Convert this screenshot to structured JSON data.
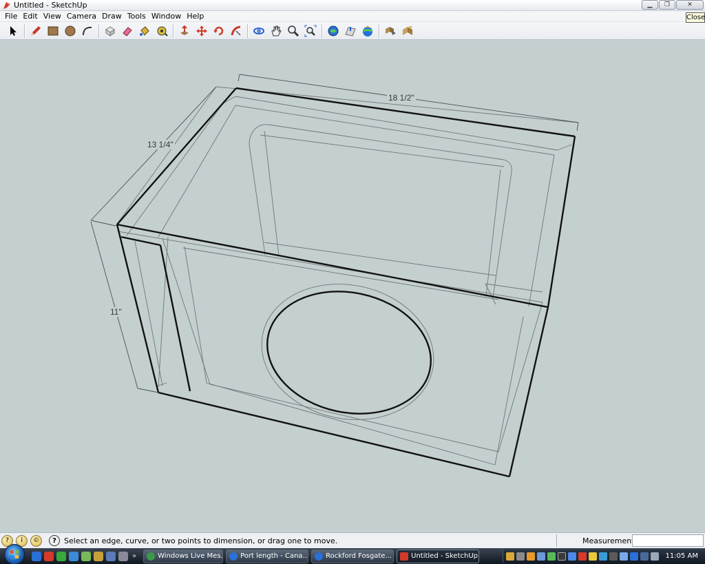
{
  "window": {
    "title": "Untitled - SketchUp",
    "close_tooltip": "Close"
  },
  "menu": [
    "File",
    "Edit",
    "View",
    "Camera",
    "Draw",
    "Tools",
    "Window",
    "Help"
  ],
  "toolbar": {
    "tools": [
      "select-icon",
      "pencil-icon",
      "rectangle-icon",
      "circle-icon",
      "arc-icon",
      "make-component-icon",
      "eraser-icon",
      "paint-bucket-icon",
      "tape-measure-icon",
      "push-pull-icon",
      "move-icon",
      "rotate-icon",
      "follow-me-icon",
      "orbit-icon",
      "pan-icon",
      "zoom-icon",
      "zoom-extents-icon",
      "get-models-icon",
      "share-model-icon",
      "google-earth-icon",
      "components-icon",
      "photo-textures-icon"
    ]
  },
  "dimensions": {
    "width": "18 1/2\"",
    "depth": "13 1/4\"",
    "height": "11\""
  },
  "status": {
    "message": "Select an edge, curve, or two points to dimension, or drag one to move.",
    "measurements_label": "Measurements",
    "measurements_value": ""
  },
  "taskbar": {
    "items": [
      {
        "label": "Windows Live Mes...",
        "icon": "messenger-icon"
      },
      {
        "label": "Port length - Cana...",
        "icon": "ie-icon"
      },
      {
        "label": "Rockford Fosgate...",
        "icon": "ie-icon"
      },
      {
        "label": "Untitled - SketchUp",
        "icon": "sketchup-icon",
        "active": true
      }
    ],
    "clock": "11:05 AM"
  },
  "colors": {
    "canvas": "#c4cfd0",
    "edge": "#111111",
    "thin_edge": "#6f7778"
  }
}
